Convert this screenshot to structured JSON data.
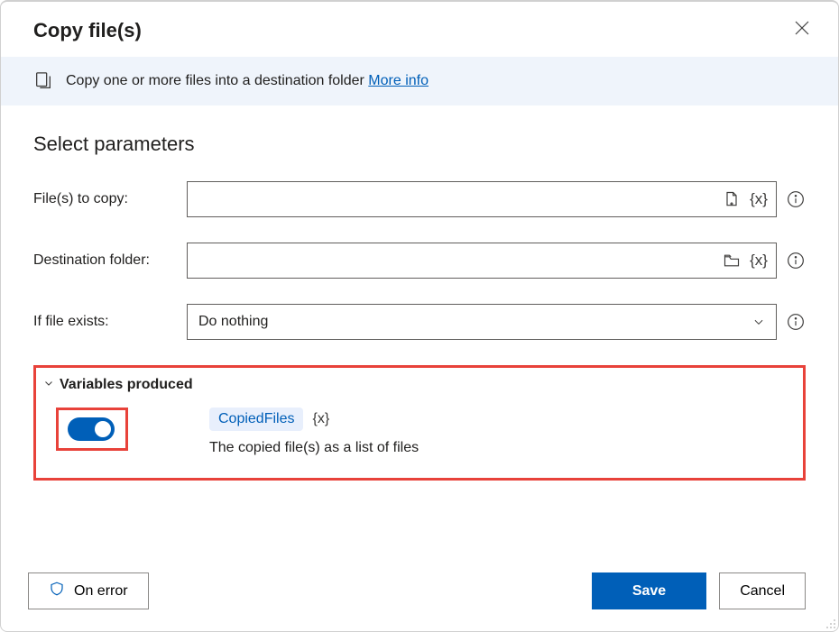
{
  "dialog": {
    "title": "Copy file(s)"
  },
  "info": {
    "text": "Copy one or more files into a destination folder ",
    "link": "More info"
  },
  "params": {
    "section_title": "Select parameters",
    "files_label": "File(s) to copy:",
    "files_value": "",
    "dest_label": "Destination folder:",
    "dest_value": "",
    "exists_label": "If file exists:",
    "exists_value": "Do nothing"
  },
  "vars": {
    "header": "Variables produced",
    "name": "CopiedFiles",
    "token": "{x}",
    "desc": "The copied file(s) as a list of files"
  },
  "footer": {
    "onerror": "On error",
    "save": "Save",
    "cancel": "Cancel"
  }
}
